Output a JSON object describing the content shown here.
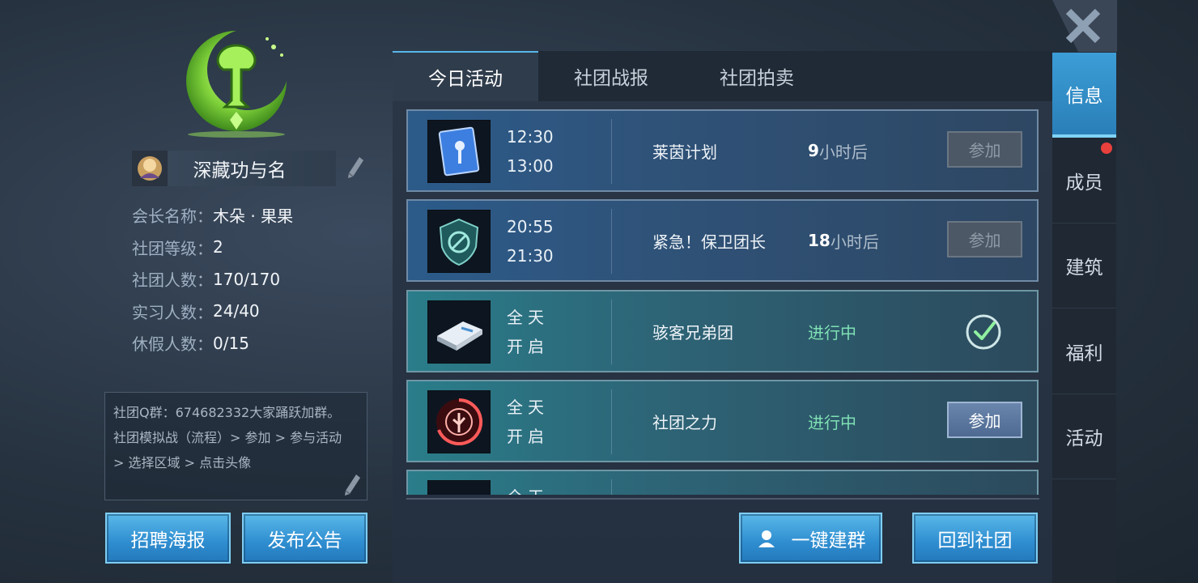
{
  "guild": {
    "name": "深藏功与名",
    "info": [
      {
        "label": "会长名称：",
        "value": "木朵 · 果果"
      },
      {
        "label": "社团等级：",
        "value": "2"
      },
      {
        "label": "社团人数：",
        "value": "170/170"
      },
      {
        "label": "实习人数：",
        "value": "24/40"
      },
      {
        "label": "休假人数：",
        "value": "0/15"
      }
    ],
    "notice_lines": [
      "社团Q群：674682332大家踊跃加群。",
      "社团模拟战（流程）> 参加 > 参与活动",
      "> 选择区域 > 点击头像"
    ]
  },
  "left_buttons": {
    "recruit": "招聘海报",
    "announce": "发布公告"
  },
  "tabs": [
    "今日活动",
    "社团战报",
    "社团拍卖"
  ],
  "activities": [
    {
      "time1": "12:30",
      "time2": "13:00",
      "name": "莱茵计划",
      "status_num": "9",
      "status_unit": "小时后",
      "status_live": "",
      "action": "参加"
    },
    {
      "time1": "20:55",
      "time2": "21:30",
      "name": "紧急！保卫团长",
      "status_num": "18",
      "status_unit": "小时后",
      "status_live": "",
      "action": "参加"
    },
    {
      "time1": "全天",
      "time2": "开启",
      "name": "骇客兄弟团",
      "status_num": "",
      "status_unit": "",
      "status_live": "进行中",
      "action": ""
    },
    {
      "time1": "全天",
      "time2": "开启",
      "name": "社团之力",
      "status_num": "",
      "status_unit": "",
      "status_live": "进行中",
      "action": "参加"
    },
    {
      "time1": "全天",
      "time2": "",
      "name": "",
      "status_num": "",
      "status_unit": "",
      "status_live": "",
      "action": ""
    }
  ],
  "bottom_buttons": {
    "group": "一键建群",
    "back": "回到社团"
  },
  "side_nav": [
    "信息",
    "成员",
    "建筑",
    "福利",
    "活动"
  ],
  "colors": {
    "accent_blue": "#2e8dd0",
    "status_green": "#7fe0b4",
    "notification_red": "#e8403c"
  }
}
